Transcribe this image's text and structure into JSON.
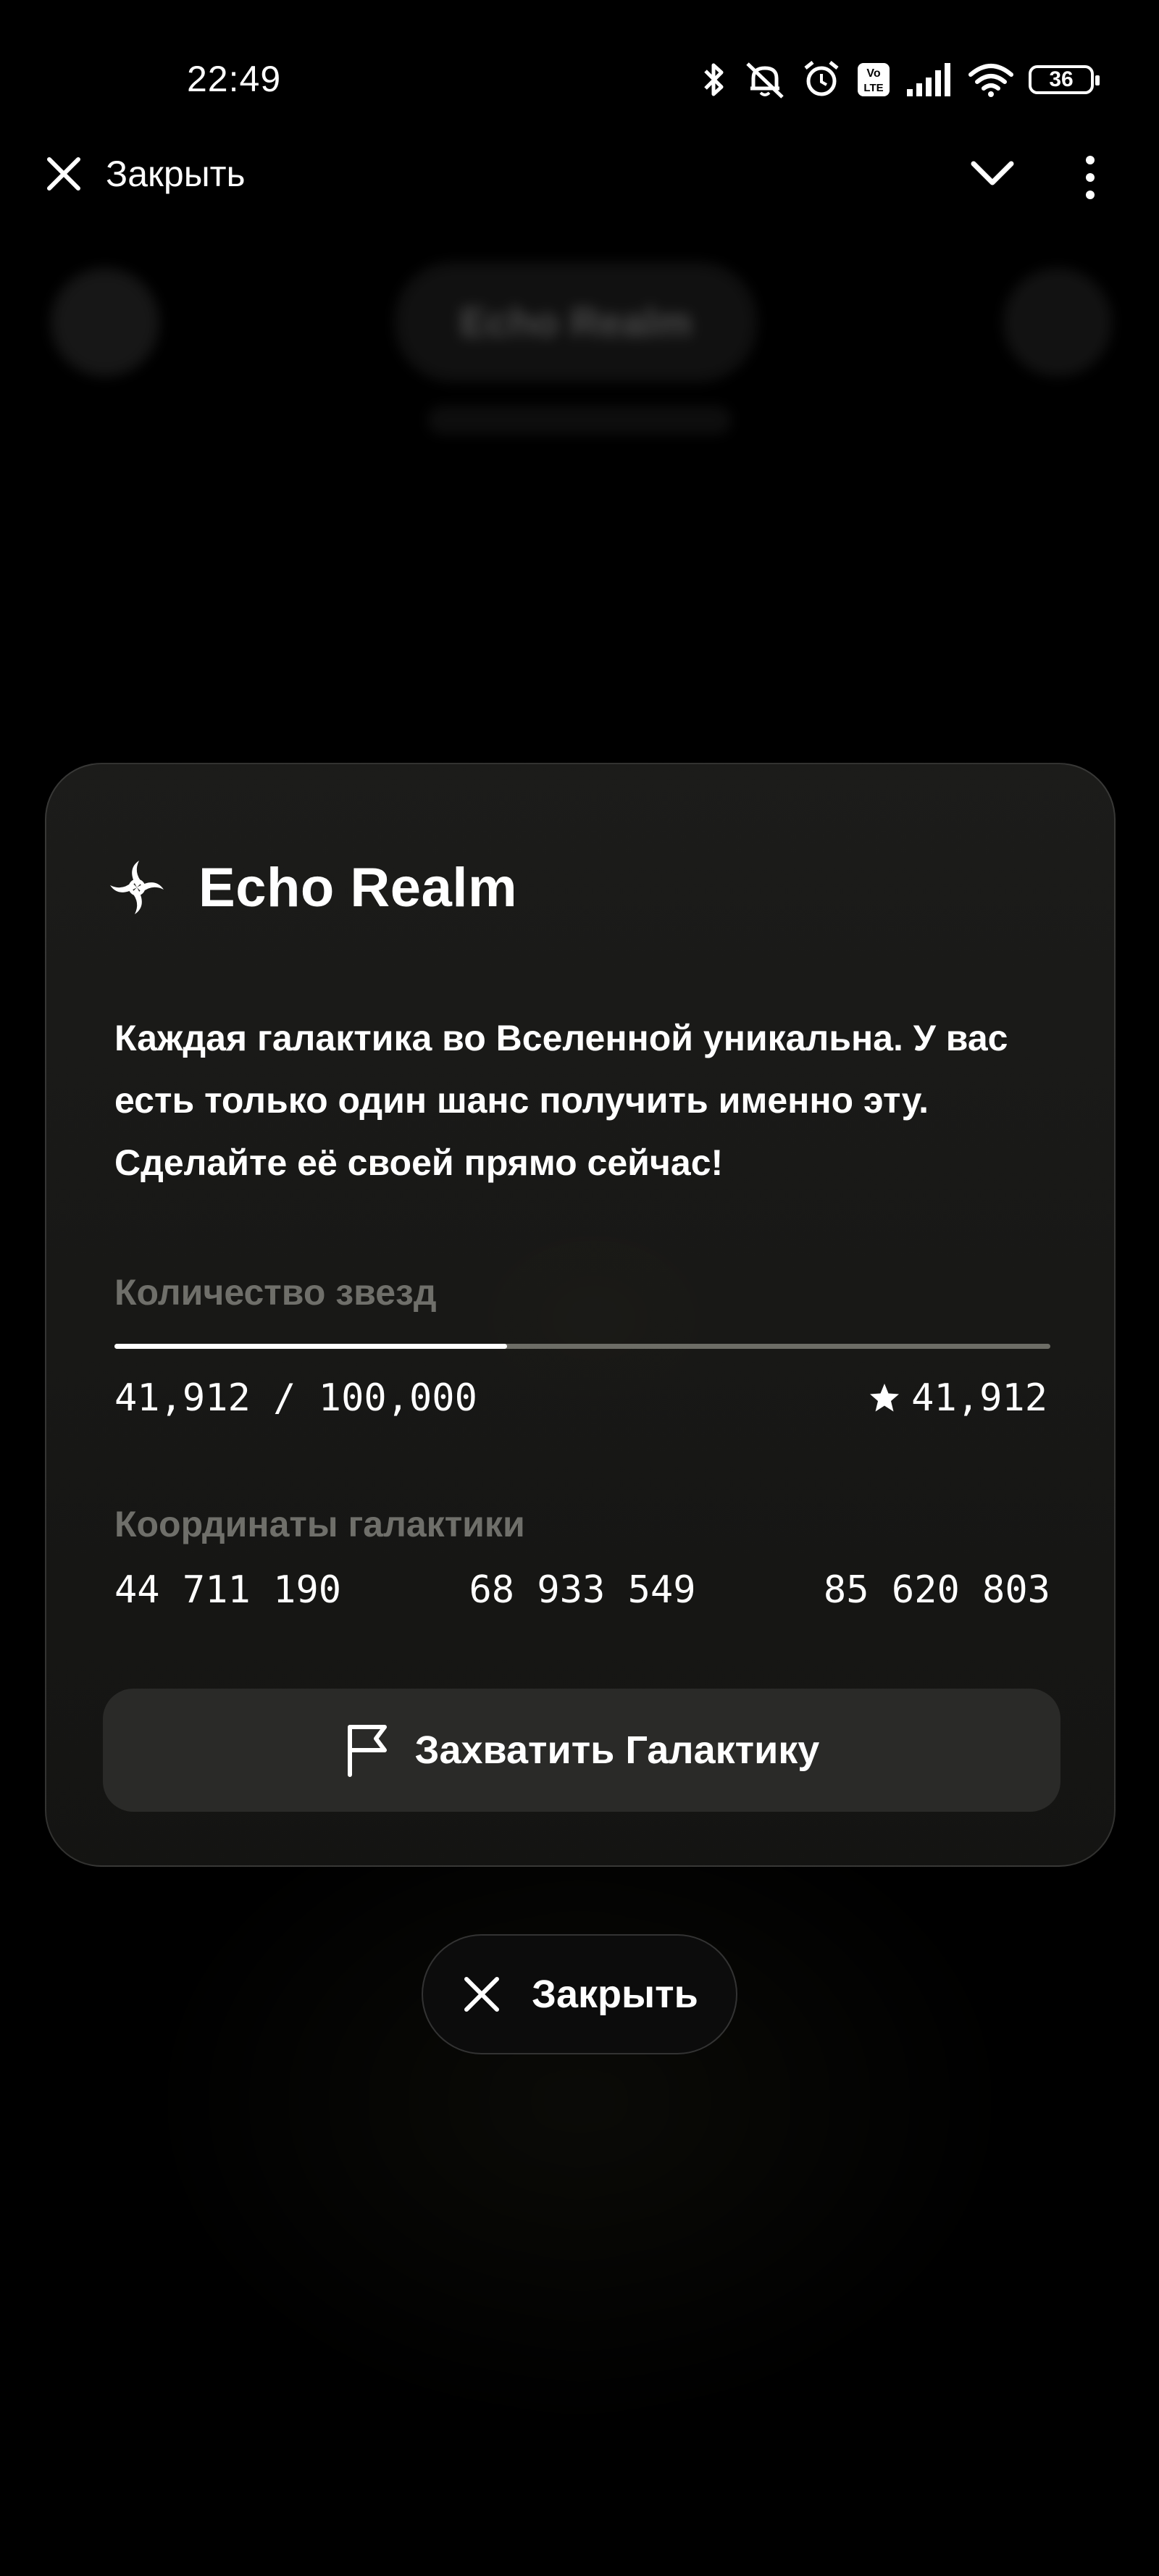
{
  "status_bar": {
    "time": "22:49",
    "battery": "36",
    "icons": [
      "bluetooth-icon",
      "mute-icon",
      "alarm-icon",
      "volte-icon",
      "signal-icon",
      "wifi-icon",
      "battery-icon"
    ],
    "volte_label_top": "Vo",
    "volte_label_bottom": "LTE"
  },
  "top_nav": {
    "close_label": "Закрыть",
    "icons": [
      "close-icon",
      "chevron-down-icon",
      "more-vert-icon"
    ]
  },
  "background_header": {
    "title": "Echo Realm"
  },
  "card": {
    "title": "Echo Realm",
    "logo_icon": "pinwheel-galaxy-icon",
    "description": "Каждая галактика во Вселенной уникальна. У вас есть только один шанс получить именно эту. Сделайте её своей прямо сейчас!",
    "stars_label": "Количество звезд",
    "stars_progress": "41,912 / 100,000",
    "stars_fraction": 0.41912,
    "stars_total": "41,912",
    "coords_label": "Координаты галактики",
    "coords": [
      "44 711 190",
      "68 933 549",
      "85 620 803"
    ],
    "capture_label": "Захватить Галактику",
    "capture_icon": "flag-icon"
  },
  "bottom": {
    "close_label": "Закрыть"
  },
  "colors": {
    "background": "#000000",
    "card": "#1c1c1a",
    "muted_text": "#6f6f6a",
    "button": "#2a2a28",
    "accent_glow": "#bea950"
  }
}
